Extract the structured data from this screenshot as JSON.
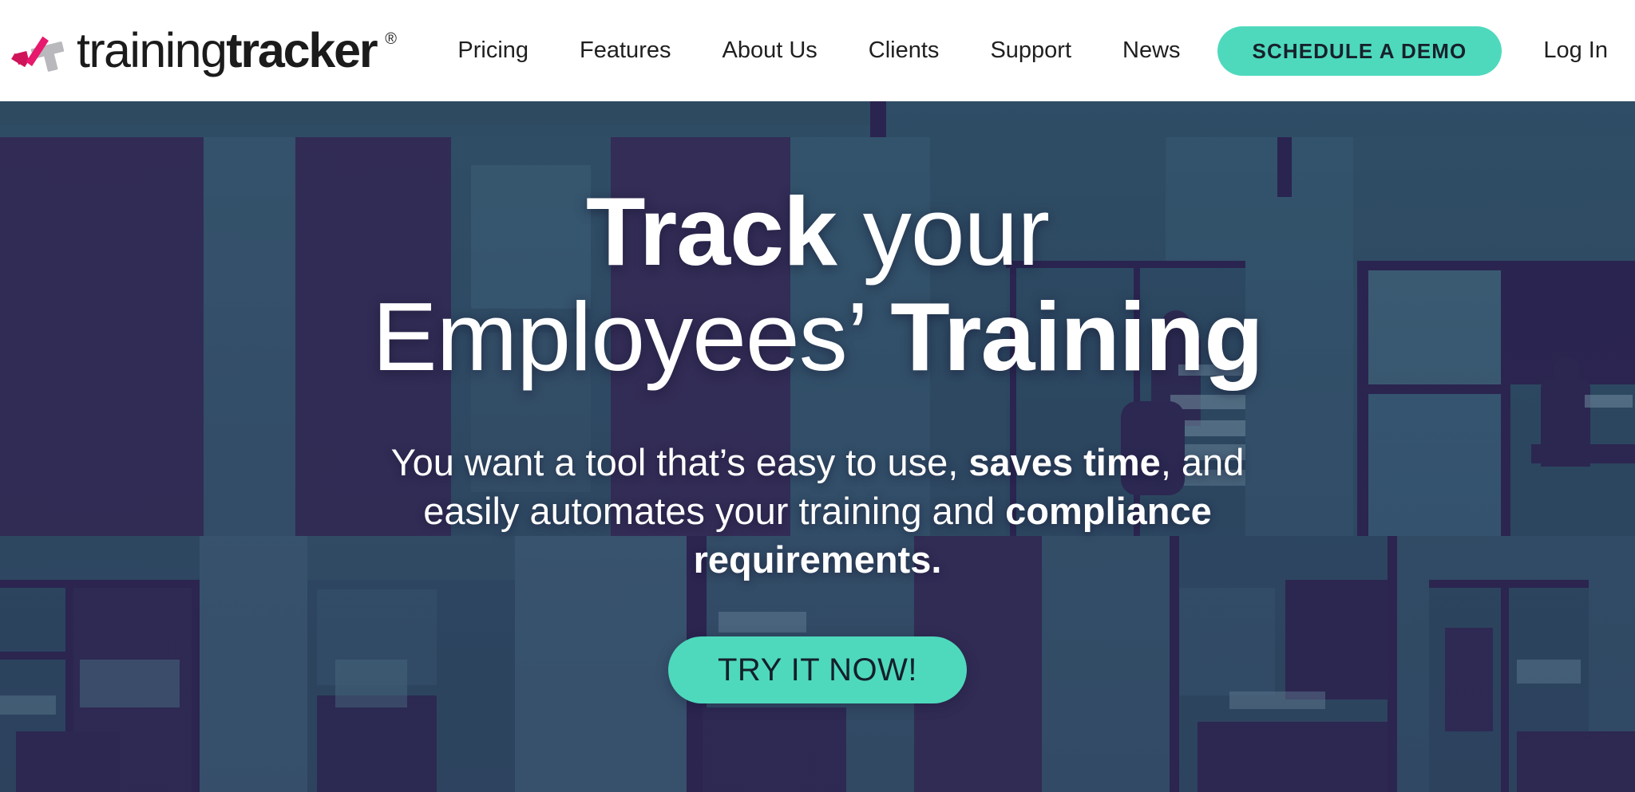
{
  "header": {
    "brand": {
      "name_light": "training",
      "name_bold": "tracker",
      "registered_mark": "®",
      "logo_icon": "checkmark-t-logo",
      "logo_colors": {
        "check": "#e01b64",
        "tee": "#b9b9bd"
      }
    },
    "nav": [
      {
        "label": "Pricing",
        "name": "pricing"
      },
      {
        "label": "Features",
        "name": "features"
      },
      {
        "label": "About Us",
        "name": "about-us"
      },
      {
        "label": "Clients",
        "name": "clients"
      },
      {
        "label": "Support",
        "name": "support"
      },
      {
        "label": "News",
        "name": "news"
      }
    ],
    "demo_button": "SCHEDULE A DEMO",
    "login_link": "Log In"
  },
  "hero": {
    "title_line1_a": "Track",
    "title_line1_b": " your",
    "title_line2_a": "Employees’ ",
    "title_line2_b": "Training",
    "sub_part1": "You want a tool that’s easy to use, ",
    "sub_bold1": "saves time",
    "sub_part2": ", and easily automates your training and ",
    "sub_bold2": "compliance requirements.",
    "cta_button": "TRY IT NOW!"
  },
  "colors": {
    "accent_teal": "#4ed9bd",
    "brand_pink": "#e01b64",
    "brand_grey": "#b9b9bd",
    "hero_navy": "#322d56",
    "hero_teal": "#33596f",
    "text_dark": "#1f1f1f"
  }
}
